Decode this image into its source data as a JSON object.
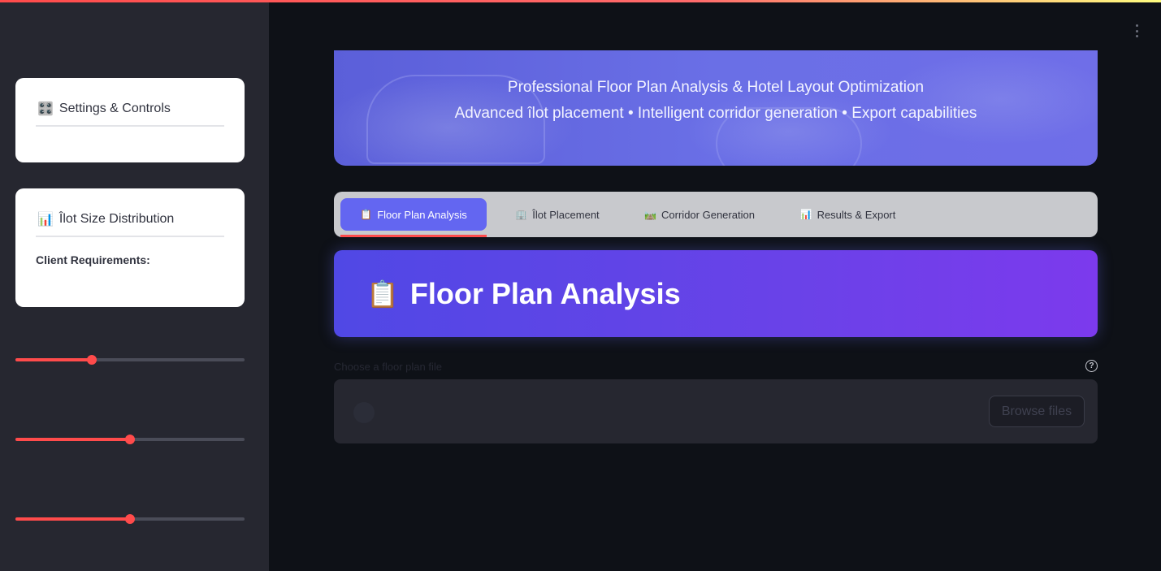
{
  "sidebar": {
    "settings_card": {
      "icon": "🎛️",
      "title": "Settings & Controls"
    },
    "ilot_card": {
      "icon": "📊",
      "title": "Îlot Size Distribution",
      "subtitle": "Client Requirements:"
    },
    "sliders": [
      {
        "label": "",
        "value_fraction": 0.335
      },
      {
        "label": "",
        "value_fraction": 0.5
      },
      {
        "label": "",
        "value_fraction": 0.5
      }
    ]
  },
  "hero": {
    "line1": "Professional Floor Plan Analysis & Hotel Layout Optimization",
    "line2": "Advanced îlot placement • Intelligent corridor generation • Export capabilities"
  },
  "tabs": [
    {
      "icon": "📋",
      "label": "Floor Plan Analysis",
      "active": true
    },
    {
      "icon": "🏢",
      "label": "Îlot Placement",
      "active": false
    },
    {
      "icon": "🛤️",
      "label": "Corridor Generation",
      "active": false
    },
    {
      "icon": "📊",
      "label": "Results & Export",
      "active": false
    }
  ],
  "section": {
    "icon": "📋",
    "title": "Floor Plan Analysis"
  },
  "uploader": {
    "label": "Choose a floor plan file",
    "help": "?",
    "button": "Browse files"
  },
  "colors": {
    "accent": "#ff4b4b",
    "tab_active": "#6366f1",
    "section_gradient_start": "#5048e5",
    "section_gradient_end": "#7c3aed",
    "background": "#0e1117",
    "sidebar": "#262730"
  }
}
